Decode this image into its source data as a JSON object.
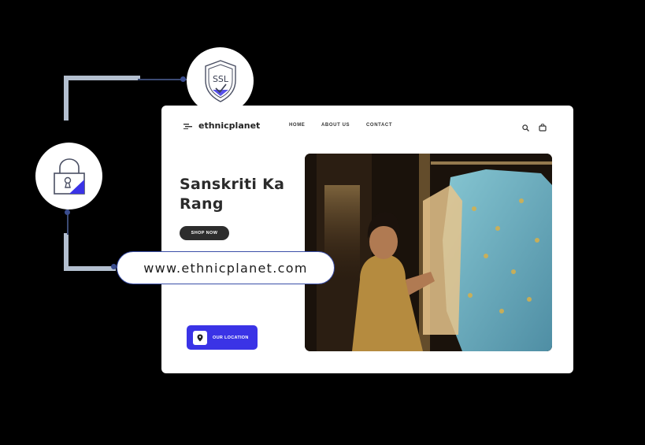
{
  "security": {
    "ssl_badge_label": "SSL",
    "lock_icon": "padlock-icon",
    "shield_icon": "shield-check-icon"
  },
  "url_bar": {
    "url": "www.ethnicplanet.com"
  },
  "site": {
    "brand": "ethnicplanet",
    "nav": {
      "home": "HOME",
      "about": "ABOUT US",
      "contact": "CONTACT"
    },
    "hero": {
      "title": "Sanskriti Ka Rang",
      "cta": "SHOP NOW"
    },
    "location_button": "OUR LOCATION"
  },
  "colors": {
    "accent": "#3a33e6",
    "connector": "#b3bfcf",
    "line": "#3b4a73"
  }
}
